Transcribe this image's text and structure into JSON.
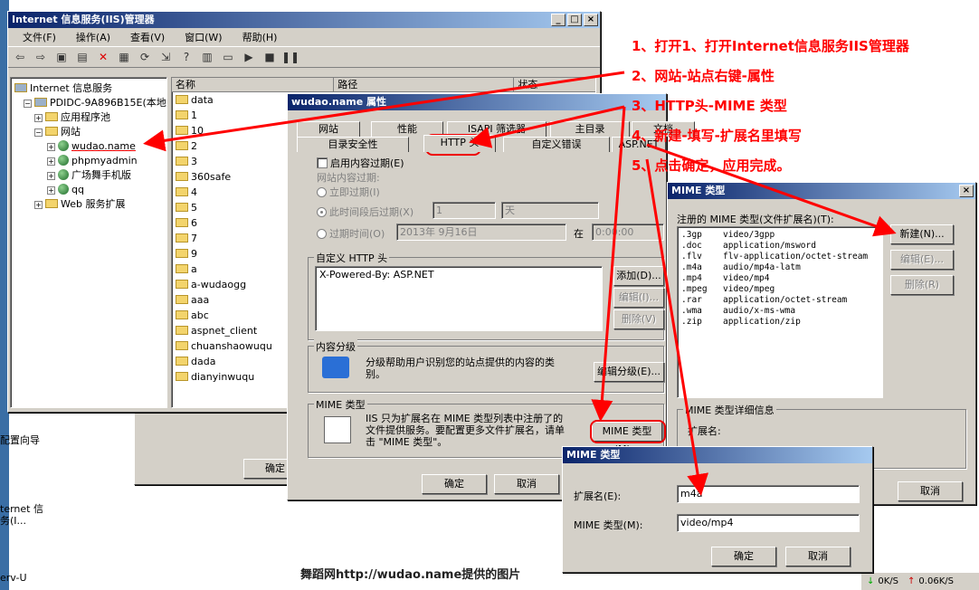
{
  "desktop": {
    "icon1_label": "配置向导",
    "icon2_label": "ternet 信\n务(I...",
    "icon3_label": "erv-U"
  },
  "iis": {
    "title": "Internet 信息服务(IIS)管理器",
    "menu": [
      "文件(F)",
      "操作(A)",
      "查看(V)",
      "窗口(W)",
      "帮助(H)"
    ],
    "tree": {
      "root": "Internet 信息服务",
      "server": "PDIDC-9A896B15E(本地计",
      "apppool": "应用程序池",
      "websites": "网站",
      "site1": "wudao.name",
      "site2": "phpmyadmin",
      "site3": "广场舞手机版",
      "site4": "qq",
      "webext": "Web 服务扩展"
    },
    "columns": {
      "name": "名称",
      "path": "路径",
      "status": "状态"
    },
    "files": [
      "data",
      "1",
      "10",
      "2",
      "3",
      "360safe",
      "4",
      "5",
      "6",
      "7",
      "9",
      "a",
      "a-wudaogg",
      "aaa",
      "abc",
      "aspnet_client",
      "chuanshaowuqu",
      "dada",
      "dianyinwuqu"
    ]
  },
  "bgwin": {
    "ok_label": "确定"
  },
  "props": {
    "title": "wudao.name 属性",
    "tabs_row1": [
      "网站",
      "性能",
      "ISAPI 筛选器",
      "主目录",
      "文档"
    ],
    "tabs_row2": [
      "目录安全性",
      "HTTP 头",
      "自定义错误",
      "ASP.NET"
    ],
    "enable_expire": "启用内容过期(E)",
    "expire_group": "网站内容过期:",
    "expire_now": "立即过期(I)",
    "expire_after": "此时间段后过期(X)",
    "expire_after_value": "1",
    "expire_after_unit": "天",
    "expire_on": "过期时间(O)",
    "expire_on_date": "2013年 9月16日",
    "expire_on_at": "在",
    "expire_on_time": "0:00:00",
    "custom_headers_label": "自定义 HTTP 头",
    "custom_header_value": "X-Powered-By: ASP.NET",
    "add_label": "添加(D)...",
    "edit_label": "编辑(I)...",
    "delete_label": "删除(V)",
    "rating_group": "内容分级",
    "rating_text": "分级帮助用户识别您的站点提供的内容的类别。",
    "rating_button": "编辑分级(E)...",
    "mime_group": "MIME 类型",
    "mime_text": "IIS 只为扩展名在 MIME 类型列表中注册了的文件提供服务。要配置更多文件扩展名，请单击 \"MIME 类型\"。",
    "mime_button": "MIME 类型(M)...",
    "ok_label": "确定",
    "cancel_label": "取消"
  },
  "mimelist": {
    "title": "MIME 类型",
    "registered_label": "注册的 MIME 类型(文件扩展名)(T):",
    "items": [
      {
        "ext": ".3gp",
        "type": "video/3gpp"
      },
      {
        "ext": ".doc",
        "type": "application/msword"
      },
      {
        "ext": ".flv",
        "type": "flv-application/octet-stream"
      },
      {
        "ext": ".m4a",
        "type": "audio/mp4a-latm"
      },
      {
        "ext": ".mp4",
        "type": "video/mp4"
      },
      {
        "ext": ".mpeg",
        "type": "video/mpeg"
      },
      {
        "ext": ".rar",
        "type": "application/octet-stream"
      },
      {
        "ext": ".wma",
        "type": "audio/x-ms-wma"
      },
      {
        "ext": ".zip",
        "type": "application/zip"
      }
    ],
    "new_label": "新建(N)...",
    "edit_label": "编辑(E)...",
    "delete_label": "删除(R)",
    "details_group": "MIME 类型详细信息",
    "ext_label": "扩展名:",
    "cancel_label": "取消"
  },
  "mimeedit": {
    "title": "MIME 类型",
    "ext_label": "扩展名(E):",
    "ext_value": "m4a",
    "type_label": "MIME 类型(M):",
    "type_value": "video/mp4",
    "ok_label": "确定",
    "cancel_label": "取消"
  },
  "instructions": [
    "1、打开1、打开Internet信息服务IIS管理器",
    "2、网站-站点右键-属性",
    "3、HTTP头-MIME 类型",
    "4、新建-填写-扩展名里填写",
    "5、点击确定，应用完成。"
  ],
  "footer_caption": "舞蹈网http://wudao.name提供的图片",
  "statusbar": {
    "down": "0K/S",
    "up": "0.06K/S"
  },
  "colors": {
    "title_active": "#0a246a",
    "annotation": "#ff0000",
    "window_face": "#d4d0c8"
  }
}
